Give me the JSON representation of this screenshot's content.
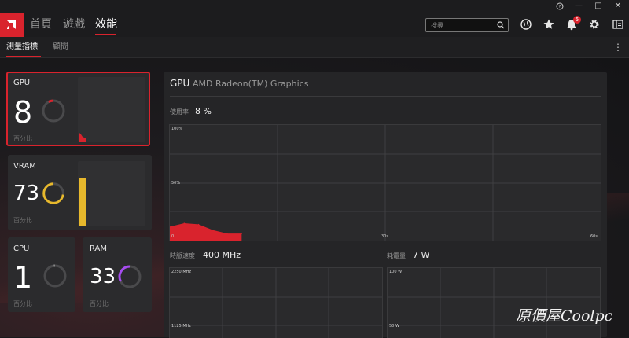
{
  "window": {
    "help_icon": "help-icon",
    "minimize_glyph": "—",
    "maximize_glyph": "□",
    "close_glyph": "✕"
  },
  "nav": {
    "tabs": [
      "首頁",
      "遊戲",
      "效能"
    ],
    "active_tab": "效能",
    "accent_color": "#d9232d",
    "search_placeholder": "搜尋",
    "notification_count": "5"
  },
  "subnav": {
    "tabs": [
      "測量指標",
      "顧問"
    ],
    "active_tab": "測量指標"
  },
  "cards": {
    "gpu": {
      "label": "GPU",
      "value": "8",
      "unit": "百分比",
      "percent": 8,
      "color": "#d9232d"
    },
    "vram": {
      "label": "VRAM",
      "value": "73",
      "unit": "百分比",
      "percent": 73,
      "color": "#e7b82c"
    },
    "cpu": {
      "label": "CPU",
      "value": "1",
      "unit": "百分比",
      "percent": 1,
      "color": "#888888"
    },
    "ram": {
      "label": "RAM",
      "value": "33",
      "unit": "百分比",
      "percent": 33,
      "color": "#a64cf0"
    }
  },
  "panel": {
    "title": "GPU",
    "device": "AMD Radeon(TM) Graphics",
    "usage_label": "使用率",
    "usage_value": "8 %",
    "usage_chart": {
      "y_top": "100%",
      "y_mid": "50%",
      "y_bottom": "0",
      "x_mid": "30s",
      "x_end": "60s"
    },
    "clock_label": "時脈速度",
    "clock_value": "400 MHz",
    "clock_chart": {
      "y_top": "2250 MHz",
      "y_mid": "1125 MHz"
    },
    "power_label": "耗電量",
    "power_value": "7 W",
    "power_chart": {
      "y_top": "100 W",
      "y_mid": "50 W"
    }
  },
  "chart_data": {
    "type": "area",
    "x": [
      0,
      2,
      4,
      6,
      8,
      10
    ],
    "values": [
      12,
      15,
      14,
      9,
      6,
      6
    ],
    "xlim": [
      0,
      60
    ],
    "ylim": [
      0,
      100
    ],
    "xlabel": "",
    "ylabel": ""
  },
  "watermark": {
    "text": "原價屋Coolpc"
  }
}
